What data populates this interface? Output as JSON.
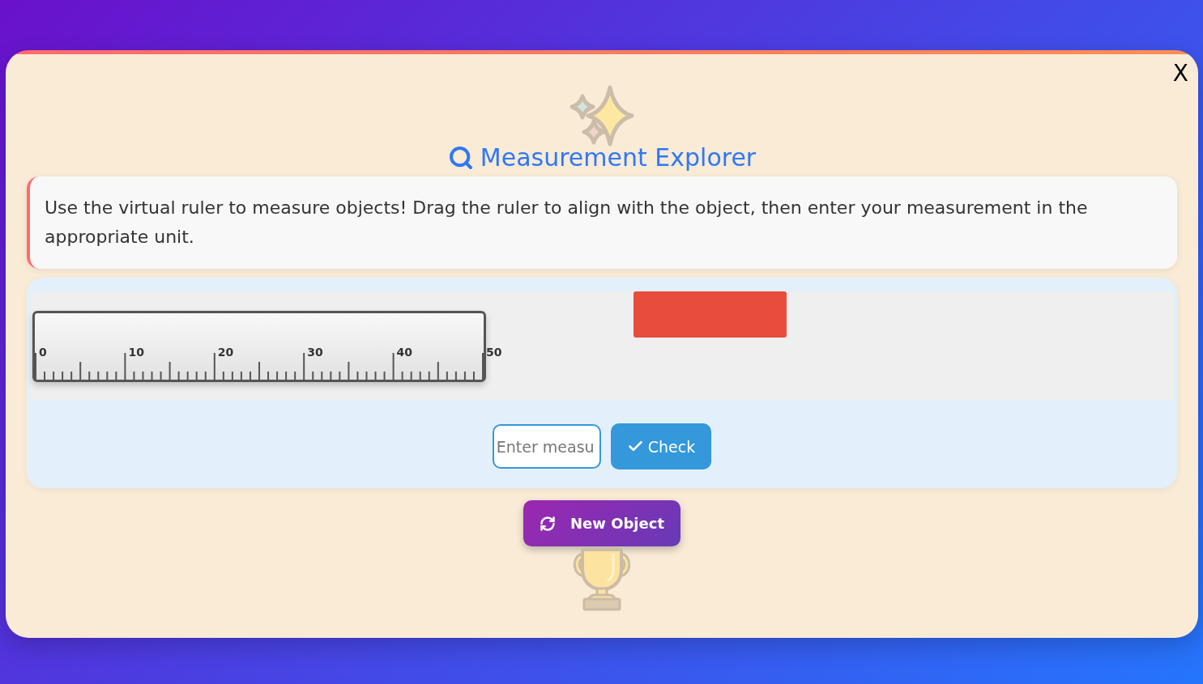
{
  "close_button": {
    "label": "X"
  },
  "title": "Measurement Explorer",
  "instructions": "Use the virtual ruler to measure objects! Drag the ruler to align with the object, then enter your measurement in the appropriate unit.",
  "workspace": {
    "ruler": {
      "labels": [
        "0",
        "10",
        "20",
        "30",
        "40",
        "50"
      ]
    }
  },
  "answer": {
    "placeholder": "Enter measu"
  },
  "check_button": {
    "label": "Check"
  },
  "new_object_button": {
    "label": "New Object"
  }
}
